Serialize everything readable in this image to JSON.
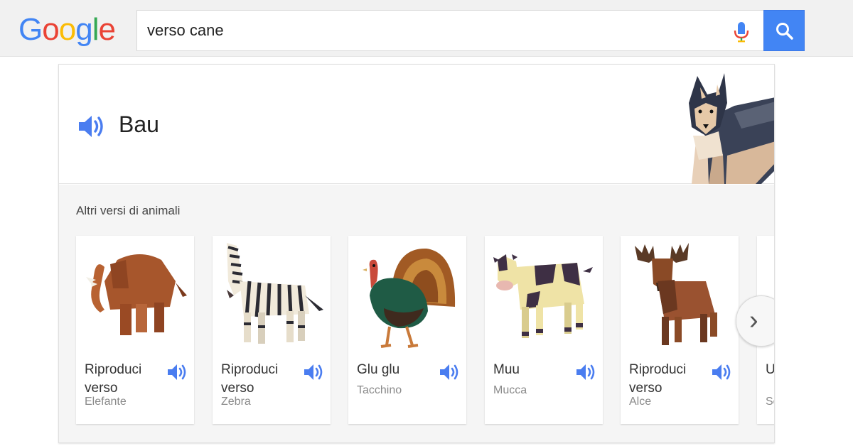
{
  "header": {
    "logo_letters": [
      {
        "ch": "G",
        "color": "#4285f4"
      },
      {
        "ch": "o",
        "color": "#ea4335"
      },
      {
        "ch": "o",
        "color": "#fbbc05"
      },
      {
        "ch": "g",
        "color": "#4285f4"
      },
      {
        "ch": "l",
        "color": "#34a853"
      },
      {
        "ch": "e",
        "color": "#ea4335"
      }
    ],
    "query": "verso cane",
    "mic_icon": "microphone-icon",
    "search_icon": "magnifier-icon"
  },
  "result": {
    "sound": "Bau",
    "speaker_icon": "speaker-icon",
    "animal_icon": "dog-illustration"
  },
  "more": {
    "title": "Altri versi di animali",
    "tiles": [
      {
        "label": "Riproduci verso",
        "animal": "Elefante",
        "icon": "elephant-illustration"
      },
      {
        "label": "Riproduci verso",
        "animal": "Zebra",
        "icon": "zebra-illustration"
      },
      {
        "label": "Glu glu",
        "animal": "Tacchino",
        "icon": "turkey-illustration"
      },
      {
        "label": "Muu",
        "animal": "Mucca",
        "icon": "cow-illustration"
      },
      {
        "label": "Riproduci verso",
        "animal": "Alce",
        "icon": "moose-illustration"
      },
      {
        "label": "Ululato",
        "animal": "Sciacallo",
        "icon": "partial-tile"
      }
    ],
    "next_icon": "chevron-right-icon"
  },
  "colors": {
    "accent": "#4285f4",
    "speaker": "#4a7df0",
    "header_bg": "#f1f1f1",
    "carousel_bg": "#f5f5f5"
  }
}
